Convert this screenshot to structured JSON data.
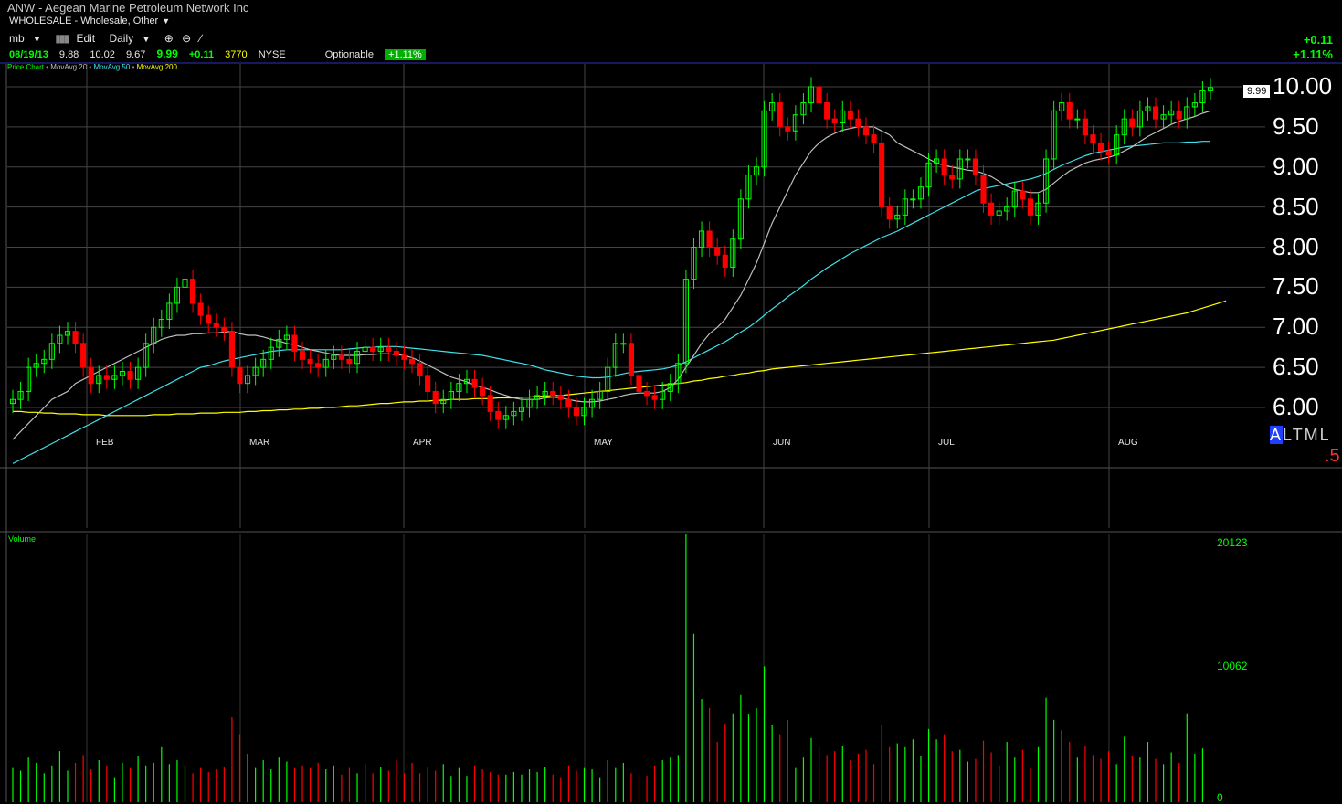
{
  "header": {
    "title": "ANW - Aegean Marine Petroleum Network Inc",
    "sector": "WHOLESALE - Wholesale, Other",
    "toolbar": {
      "user": "mb",
      "edit": "Edit",
      "period": "Daily"
    },
    "quote": {
      "date": "08/19/13",
      "open": "9.88",
      "high": "10.02",
      "low": "9.67",
      "close": "9.99",
      "change": "+0.11",
      "volume": "3770",
      "exchange": "NYSE",
      "optionable": "Optionable",
      "pct_badge": "+1.11%"
    },
    "right_change": "+0.11",
    "right_pct": "+1.11%"
  },
  "legend": {
    "price_chart": "Price Chart",
    "ma20": "MovAvg 20",
    "ma50": "MovAvg 50",
    "ma200": "MovAvg 200"
  },
  "last_price_tag": "9.99",
  "altml": {
    "a": "A",
    "rest": "LTML"
  },
  "dot5": ".5",
  "volume_label": "Volume",
  "colors": {
    "up": "#00ff00",
    "down": "#ff0000",
    "ma20": "#bfbfbf",
    "ma50": "#40e0e8",
    "ma200": "#ffff00",
    "grid": "#444444"
  },
  "chart_data": {
    "type": "candlestick",
    "price_axis": {
      "min": 6.0,
      "max": 10.0,
      "ticks": [
        "10.00",
        "9.50",
        "9.00",
        "8.50",
        "8.00",
        "7.50",
        "7.00",
        "6.50",
        "6.00"
      ]
    },
    "month_labels": [
      "FEB",
      "MAR",
      "APR",
      "MAY",
      "JUN",
      "JUL",
      "AUG"
    ],
    "volume_axis": {
      "ticks": [
        "20123",
        "10062",
        "0"
      ],
      "max": 20123
    },
    "closes": [
      6.1,
      6.2,
      6.5,
      6.55,
      6.6,
      6.8,
      6.9,
      6.95,
      6.8,
      6.5,
      6.3,
      6.4,
      6.35,
      6.4,
      6.45,
      6.35,
      6.5,
      6.8,
      7.0,
      7.1,
      7.3,
      7.5,
      7.6,
      7.3,
      7.15,
      7.05,
      7.0,
      6.95,
      6.5,
      6.3,
      6.4,
      6.5,
      6.6,
      6.75,
      6.85,
      6.9,
      6.7,
      6.6,
      6.55,
      6.5,
      6.6,
      6.65,
      6.6,
      6.55,
      6.7,
      6.75,
      6.7,
      6.75,
      6.7,
      6.65,
      6.6,
      6.55,
      6.4,
      6.2,
      6.05,
      6.1,
      6.2,
      6.3,
      6.35,
      6.25,
      6.15,
      5.95,
      5.85,
      5.9,
      5.95,
      6.0,
      6.1,
      6.15,
      6.2,
      6.15,
      6.1,
      6.0,
      5.9,
      6.0,
      6.1,
      6.2,
      6.5,
      6.8,
      6.8,
      6.4,
      6.2,
      6.15,
      6.1,
      6.2,
      6.3,
      6.55,
      7.6,
      8.0,
      8.2,
      8.0,
      7.9,
      7.75,
      8.1,
      8.6,
      8.9,
      9.0,
      9.7,
      9.8,
      9.5,
      9.45,
      9.65,
      9.8,
      10.0,
      9.8,
      9.6,
      9.55,
      9.7,
      9.6,
      9.5,
      9.4,
      9.3,
      8.5,
      8.35,
      8.4,
      8.6,
      8.6,
      8.75,
      9.05,
      9.1,
      8.9,
      8.85,
      9.1,
      9.1,
      8.9,
      8.55,
      8.4,
      8.45,
      8.5,
      8.7,
      8.6,
      8.4,
      8.55,
      9.1,
      9.7,
      9.8,
      9.6,
      9.6,
      9.4,
      9.3,
      9.2,
      9.15,
      9.4,
      9.6,
      9.5,
      9.7,
      9.75,
      9.6,
      9.65,
      9.7,
      9.6,
      9.75,
      9.8,
      9.95,
      9.99
    ],
    "ma20": [
      5.6,
      5.7,
      5.8,
      5.9,
      6.0,
      6.1,
      6.15,
      6.2,
      6.3,
      6.35,
      6.4,
      6.45,
      6.5,
      6.55,
      6.6,
      6.65,
      6.7,
      6.75,
      6.8,
      6.85,
      6.88,
      6.9,
      6.9,
      6.92,
      6.92,
      6.93,
      6.93,
      6.94,
      6.95,
      6.92,
      6.9,
      6.9,
      6.88,
      6.85,
      6.83,
      6.8,
      6.78,
      6.75,
      6.72,
      6.7,
      6.68,
      6.66,
      6.65,
      6.65,
      6.65,
      6.66,
      6.66,
      6.67,
      6.67,
      6.66,
      6.65,
      6.62,
      6.58,
      6.53,
      6.48,
      6.43,
      6.38,
      6.35,
      6.32,
      6.28,
      6.25,
      6.22,
      6.18,
      6.15,
      6.12,
      6.1,
      6.1,
      6.1,
      6.12,
      6.13,
      6.12,
      6.1,
      6.08,
      6.07,
      6.07,
      6.08,
      6.1,
      6.12,
      6.15,
      6.17,
      6.18,
      6.18,
      6.18,
      6.2,
      6.25,
      6.35,
      6.5,
      6.65,
      6.8,
      6.92,
      7.0,
      7.1,
      7.25,
      7.4,
      7.6,
      7.8,
      8.05,
      8.3,
      8.5,
      8.7,
      8.9,
      9.05,
      9.2,
      9.3,
      9.37,
      9.42,
      9.46,
      9.48,
      9.5,
      9.5,
      9.5,
      9.45,
      9.4,
      9.3,
      9.25,
      9.2,
      9.15,
      9.1,
      9.05,
      9.02,
      9.0,
      8.98,
      8.96,
      8.95,
      8.92,
      8.88,
      8.82,
      8.76,
      8.72,
      8.7,
      8.68,
      8.68,
      8.72,
      8.8,
      8.88,
      8.95,
      9.0,
      9.05,
      9.08,
      9.1,
      9.12,
      9.15,
      9.2,
      9.25,
      9.32,
      9.38,
      9.43,
      9.48,
      9.53,
      9.57,
      9.6,
      9.63,
      9.67,
      9.7
    ],
    "ma50": [
      5.3,
      5.35,
      5.4,
      5.45,
      5.5,
      5.55,
      5.6,
      5.65,
      5.7,
      5.75,
      5.8,
      5.85,
      5.9,
      5.95,
      6.0,
      6.05,
      6.1,
      6.15,
      6.2,
      6.25,
      6.3,
      6.35,
      6.4,
      6.45,
      6.5,
      6.52,
      6.55,
      6.58,
      6.6,
      6.62,
      6.64,
      6.66,
      6.68,
      6.7,
      6.71,
      6.72,
      6.72,
      6.72,
      6.72,
      6.72,
      6.72,
      6.72,
      6.72,
      6.73,
      6.74,
      6.75,
      6.75,
      6.76,
      6.76,
      6.76,
      6.75,
      6.74,
      6.73,
      6.72,
      6.71,
      6.7,
      6.69,
      6.68,
      6.67,
      6.66,
      6.65,
      6.63,
      6.61,
      6.59,
      6.57,
      6.55,
      6.53,
      6.5,
      6.47,
      6.45,
      6.43,
      6.41,
      6.39,
      6.38,
      6.37,
      6.37,
      6.38,
      6.4,
      6.42,
      6.44,
      6.45,
      6.46,
      6.47,
      6.48,
      6.5,
      6.53,
      6.57,
      6.62,
      6.67,
      6.72,
      6.77,
      6.82,
      6.88,
      6.94,
      7.0,
      7.07,
      7.15,
      7.23,
      7.3,
      7.38,
      7.45,
      7.52,
      7.6,
      7.67,
      7.74,
      7.8,
      7.86,
      7.92,
      7.97,
      8.02,
      8.07,
      8.12,
      8.16,
      8.2,
      8.25,
      8.3,
      8.35,
      8.4,
      8.45,
      8.5,
      8.55,
      8.6,
      8.65,
      8.7,
      8.73,
      8.75,
      8.77,
      8.79,
      8.81,
      8.83,
      8.85,
      8.88,
      8.92,
      8.97,
      9.02,
      9.06,
      9.1,
      9.14,
      9.17,
      9.19,
      9.21,
      9.23,
      9.25,
      9.26,
      9.27,
      9.28,
      9.29,
      9.3,
      9.3,
      9.3,
      9.31,
      9.31,
      9.32,
      9.32
    ],
    "ma200": [
      5.95,
      5.95,
      5.94,
      5.94,
      5.93,
      5.93,
      5.92,
      5.92,
      5.92,
      5.91,
      5.91,
      5.91,
      5.9,
      5.9,
      5.9,
      5.9,
      5.9,
      5.9,
      5.91,
      5.91,
      5.91,
      5.92,
      5.92,
      5.92,
      5.93,
      5.93,
      5.93,
      5.94,
      5.94,
      5.94,
      5.95,
      5.95,
      5.96,
      5.96,
      5.97,
      5.97,
      5.98,
      5.98,
      5.99,
      5.99,
      6.0,
      6.0,
      6.01,
      6.02,
      6.02,
      6.03,
      6.04,
      6.05,
      6.05,
      6.06,
      6.07,
      6.07,
      6.08,
      6.08,
      6.09,
      6.09,
      6.1,
      6.1,
      6.1,
      6.11,
      6.11,
      6.11,
      6.12,
      6.12,
      6.12,
      6.13,
      6.13,
      6.14,
      6.14,
      6.15,
      6.15,
      6.16,
      6.17,
      6.18,
      6.19,
      6.2,
      6.21,
      6.22,
      6.23,
      6.24,
      6.25,
      6.26,
      6.27,
      6.28,
      6.29,
      6.3,
      6.31,
      6.33,
      6.34,
      6.36,
      6.37,
      6.39,
      6.4,
      6.42,
      6.43,
      6.45,
      6.46,
      6.48,
      6.49,
      6.5,
      6.51,
      6.52,
      6.53,
      6.54,
      6.55,
      6.56,
      6.57,
      6.58,
      6.59,
      6.6,
      6.61,
      6.62,
      6.63,
      6.64,
      6.65,
      6.66,
      6.67,
      6.68,
      6.69,
      6.7,
      6.71,
      6.72,
      6.73,
      6.74,
      6.75,
      6.76,
      6.77,
      6.78,
      6.79,
      6.8,
      6.81,
      6.82,
      6.83,
      6.84,
      6.86,
      6.88,
      6.9,
      6.92,
      6.94,
      6.96,
      6.98,
      7.0,
      7.02,
      7.04,
      7.06,
      7.08,
      7.1,
      7.12,
      7.14,
      7.16,
      7.18,
      7.21,
      7.24,
      7.27,
      7.3,
      7.33
    ],
    "volumes": [
      2200,
      2000,
      3000,
      2600,
      1800,
      2400,
      3500,
      2000,
      2600,
      3200,
      2100,
      2800,
      2400,
      1500,
      2600,
      2200,
      3100,
      2400,
      2600,
      3800,
      2500,
      2800,
      2400,
      1800,
      2200,
      1900,
      2100,
      2300,
      6100,
      4800,
      3300,
      2200,
      2800,
      2100,
      3000,
      2700,
      2200,
      2400,
      2200,
      2600,
      2100,
      2400,
      1700,
      2200,
      1800,
      2500,
      1800,
      2300,
      2000,
      2800,
      1800,
      2600,
      1800,
      2300,
      2000,
      2500,
      1600,
      2200,
      1600,
      2400,
      2100,
      1900,
      1700,
      1700,
      1900,
      1700,
      2100,
      1900,
      2300,
      1700,
      1500,
      2400,
      2000,
      2200,
      2100,
      1500,
      2800,
      2200,
      2600,
      1800,
      1700,
      1600,
      2400,
      2800,
      3000,
      3200,
      20123,
      12500,
      7500,
      6800,
      4200,
      5600,
      6400,
      7800,
      6300,
      6800,
      10000,
      5500,
      4800,
      5900,
      2200,
      3000,
      4500,
      3800,
      3200,
      3500,
      3900,
      2800,
      3300,
      3600,
      2500,
      5500,
      3800,
      4100,
      3800,
      4400,
      3100,
      5200,
      4400,
      4800,
      3500,
      3600,
      2700,
      2900,
      4300,
      3400,
      2400,
      4200,
      3000,
      3600,
      2200,
      3800,
      7600,
      5900,
      5100,
      4200,
      3000,
      3900,
      3200,
      2900,
      3500,
      2500,
      4600,
      3100,
      3000,
      4200,
      2900,
      2500,
      3400,
      2600,
      6400,
      3300,
      3700
    ]
  }
}
